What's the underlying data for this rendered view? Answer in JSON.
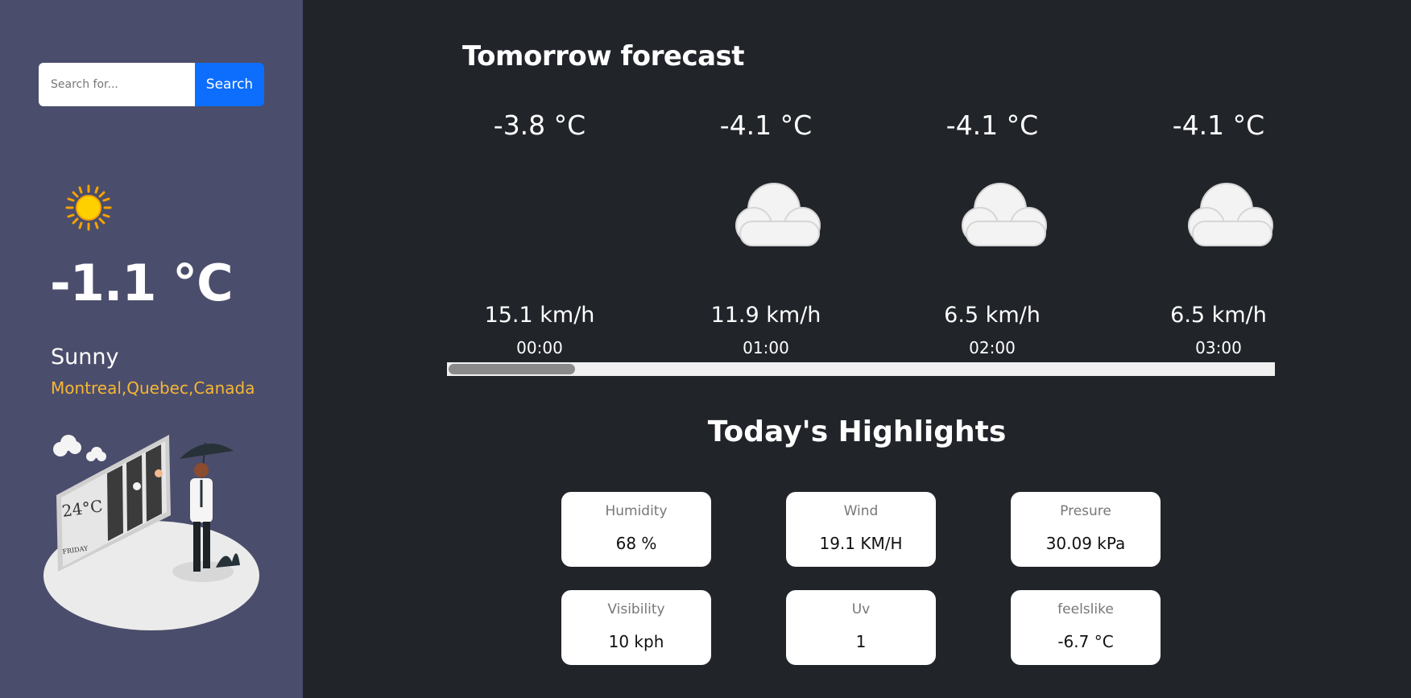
{
  "search": {
    "placeholder": "Search for...",
    "button_label": "Search"
  },
  "current": {
    "icon": "sun-icon",
    "temperature": "-1.1 °C",
    "condition": "Sunny",
    "location": "Montreal,Quebec,Canada"
  },
  "forecast": {
    "title": "Tomorrow forecast",
    "items": [
      {
        "temp": "-3.8 °C",
        "icon": "moon-icon",
        "wind": "15.1 km/h",
        "time": "00:00"
      },
      {
        "temp": "-4.1 °C",
        "icon": "moon-cloud-icon",
        "wind": "11.9 km/h",
        "time": "01:00"
      },
      {
        "temp": "-4.1 °C",
        "icon": "moon-cloud-icon",
        "wind": "6.5 km/h",
        "time": "02:00"
      },
      {
        "temp": "-4.1 °C",
        "icon": "moon-cloud-icon",
        "wind": "6.5 km/h",
        "time": "03:00"
      }
    ],
    "scroll_position": 0.0
  },
  "highlights": {
    "title": "Today's Highlights",
    "cards": [
      {
        "label": "Humidity",
        "value": "68 %"
      },
      {
        "label": "Wind",
        "value": "19.1 KM/H"
      },
      {
        "label": "Presure",
        "value": "30.09 kPa"
      },
      {
        "label": "Visibility",
        "value": "10 kph"
      },
      {
        "label": "Uv",
        "value": "1"
      },
      {
        "label": "feelslike",
        "value": "-6.7 °C"
      }
    ]
  },
  "colors": {
    "sidebar_bg": "#4b4d6c",
    "main_bg": "#212429",
    "accent": "#0d6efd",
    "location": "#f7b733"
  }
}
